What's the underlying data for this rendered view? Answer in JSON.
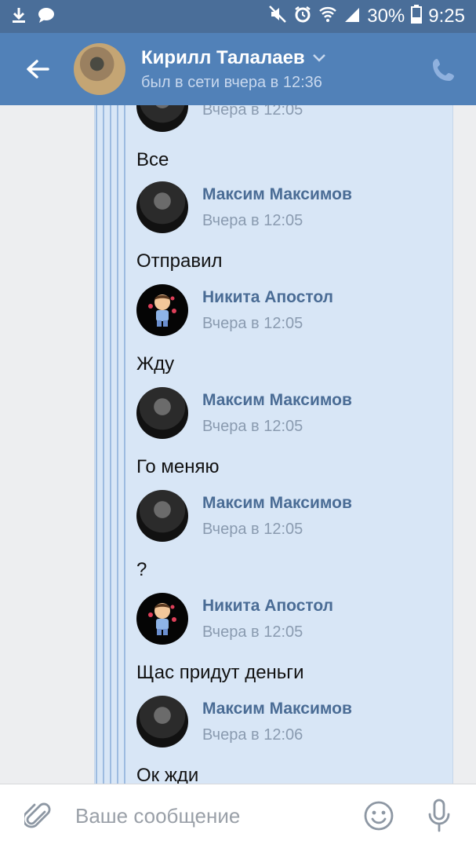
{
  "status_bar": {
    "icons": [
      "download-icon",
      "chat-bubble-icon",
      "mute-icon",
      "alarm-icon",
      "wifi-icon",
      "signal-icon",
      "battery-icon"
    ],
    "battery": "30%",
    "time": "9:25"
  },
  "header": {
    "title": "Кирилл Талалаев",
    "subtitle": "был в сети вчера в 12:36"
  },
  "messages": [
    {
      "author": "",
      "time": "Вчера в 12:05",
      "text": "Все",
      "avatar": "maxim"
    },
    {
      "author": "Максим Максимов",
      "time": "Вчера в 12:05",
      "text": "Отправил",
      "avatar": "maxim"
    },
    {
      "author": "Никита Апостол",
      "time": "Вчера в 12:05",
      "text": "Жду",
      "avatar": "nikita"
    },
    {
      "author": "Максим Максимов",
      "time": "Вчера в 12:05",
      "text": "Го меняю",
      "avatar": "maxim"
    },
    {
      "author": "Максим Максимов",
      "time": "Вчера в 12:05",
      "text": "?",
      "avatar": "maxim"
    },
    {
      "author": "Никита Апостол",
      "time": "Вчера в 12:05",
      "text": "Щас придут деньги",
      "avatar": "nikita"
    },
    {
      "author": "Максим Максимов",
      "time": "Вчера в 12:06",
      "text": "Ок жди",
      "avatar": "maxim"
    }
  ],
  "input": {
    "placeholder": "Ваше сообщение"
  },
  "colors": {
    "status_bar": "#4a6e99",
    "header": "#5181b8",
    "forward_bubble": "#d8e6f6",
    "author": "#4a6c95"
  }
}
